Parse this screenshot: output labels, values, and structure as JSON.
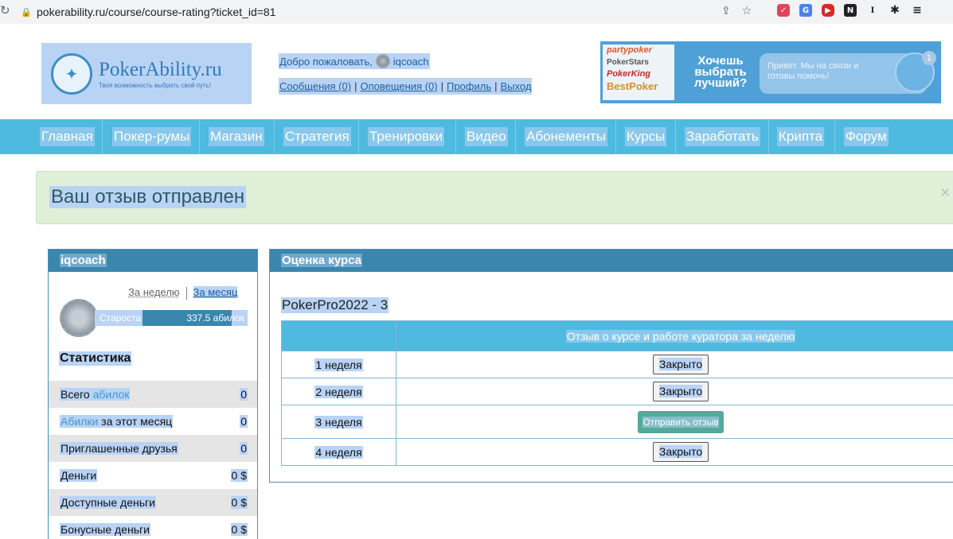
{
  "browser": {
    "reload_icon": "reload-icon",
    "url": "pokerability.ru/course/course-rating?ticket_id=81"
  },
  "header": {
    "logo_name": "PokerAbility.ru",
    "logo_tagline": "Твоя возможность выбрать свой путь!",
    "welcome": "Добро пожаловать,",
    "username": "iqcoach",
    "links": [
      "Сообщения (0)",
      "Оповещения (0)",
      "Профиль",
      "Выход"
    ]
  },
  "banner": {
    "rooms": [
      "partypoker",
      "PokerStars",
      "PokerKing",
      "BestPoker"
    ],
    "title_line1": "Хочешь",
    "title_line2": "выбрать",
    "title_line3": "лучший?",
    "chat_text": "Привет. Мы на связи и готовы помочь!",
    "chat_badge": "1"
  },
  "nav": {
    "items": [
      "Главная",
      "Покер-румы",
      "Магазин",
      "Стратегия",
      "Тренировки",
      "Видео",
      "Абонементы",
      "Курсы",
      "Заработать",
      "Крипта",
      "Форум"
    ]
  },
  "alert": {
    "text": "Ваш отзыв отправлен",
    "close": "×"
  },
  "user_panel": {
    "title": "iqcoach",
    "period_week": "За неделю",
    "period_month": "За месяц",
    "rank_name": "Староста",
    "rank_value": "337.5 абилок",
    "rank_progress": 0.5,
    "stats_title": "Статистика",
    "stats": [
      {
        "pre": "Всего ",
        "hl": "абилок",
        "post": "",
        "value": "0"
      },
      {
        "pre": "",
        "hl": "Абилки",
        "post": " за этот месяц",
        "value": "0"
      },
      {
        "pre": "Приглашенные друзья",
        "hl": "",
        "post": "",
        "value": "0"
      },
      {
        "pre": "Деньги",
        "hl": "",
        "post": "",
        "value": "0 $"
      },
      {
        "pre": "Доступные деньги",
        "hl": "",
        "post": "",
        "value": "0 $"
      },
      {
        "pre": "Бонусные деньги",
        "hl": "",
        "post": "",
        "value": "0 $"
      }
    ]
  },
  "course_panel": {
    "title": "Оценка курса",
    "course_name": "PokerPro2022 - 3",
    "column_header": "Отзыв о курсе и работе куратора за неделю",
    "weeks": [
      {
        "label": "1 неделя",
        "action": "Закрыто",
        "type": "closed"
      },
      {
        "label": "2 неделя",
        "action": "Закрыто",
        "type": "closed"
      },
      {
        "label": "3 неделя",
        "action": "Отправить отзыв",
        "type": "send"
      },
      {
        "label": "4 неделя",
        "action": "Закрыто",
        "type": "closed"
      }
    ]
  },
  "colors": {
    "nav_bg": "#4ebae0",
    "panel_header": "#3a86ad",
    "alert_bg": "#dff0d8",
    "send_button": "#52a99c",
    "selection": "#b9d3f5"
  }
}
